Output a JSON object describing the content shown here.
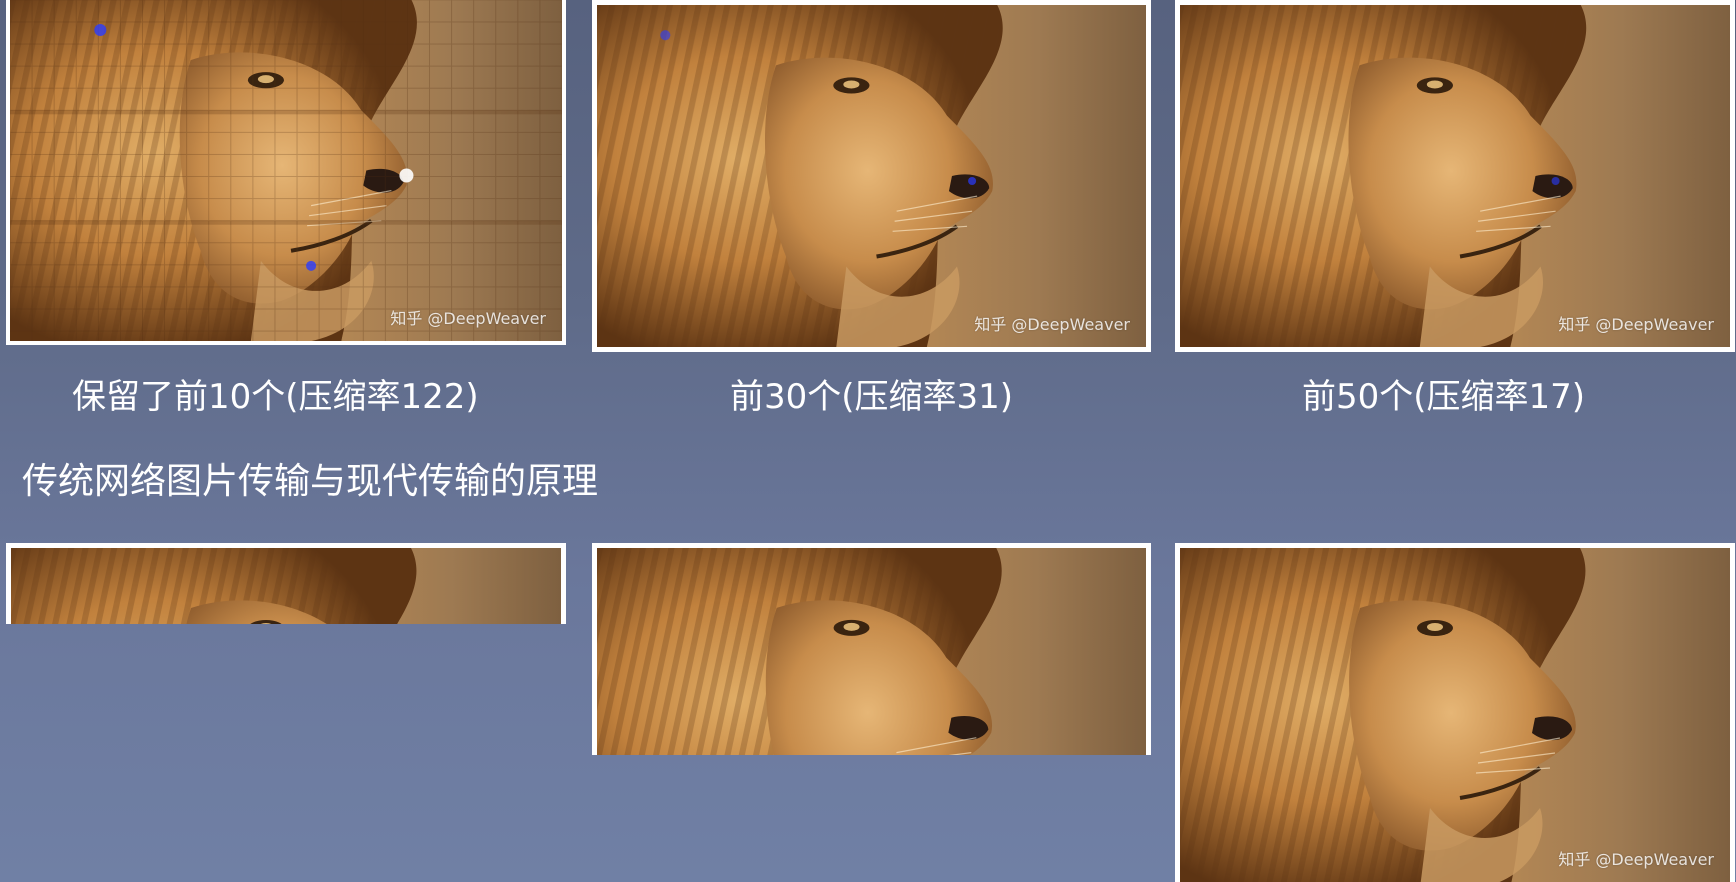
{
  "watermark": "知乎 @DeepWeaver",
  "captions": [
    "保留了前10个(压缩率122)",
    "前30个(压缩率31)",
    "前50个(压缩率17)"
  ],
  "heading": "传统网络图片传输与现代传输的原理",
  "images": {
    "top_left": "lion photo, heavily compressed, blocky",
    "top_middle": "lion photo, medium compression",
    "top_right": "lion photo, low compression",
    "bottom_left": "lion photo, partially loaded",
    "bottom_middle": "lion photo, partially loaded",
    "bottom_right": "lion photo, nearly fully loaded"
  },
  "colors": {
    "background_top": "#57627f",
    "background_bottom": "#7080a5",
    "frame": "#ffffff",
    "text": "#ffffff",
    "fur_light": "#d9a35a",
    "fur_dark": "#6b3f18",
    "bg_blur": "#a47a4a"
  }
}
